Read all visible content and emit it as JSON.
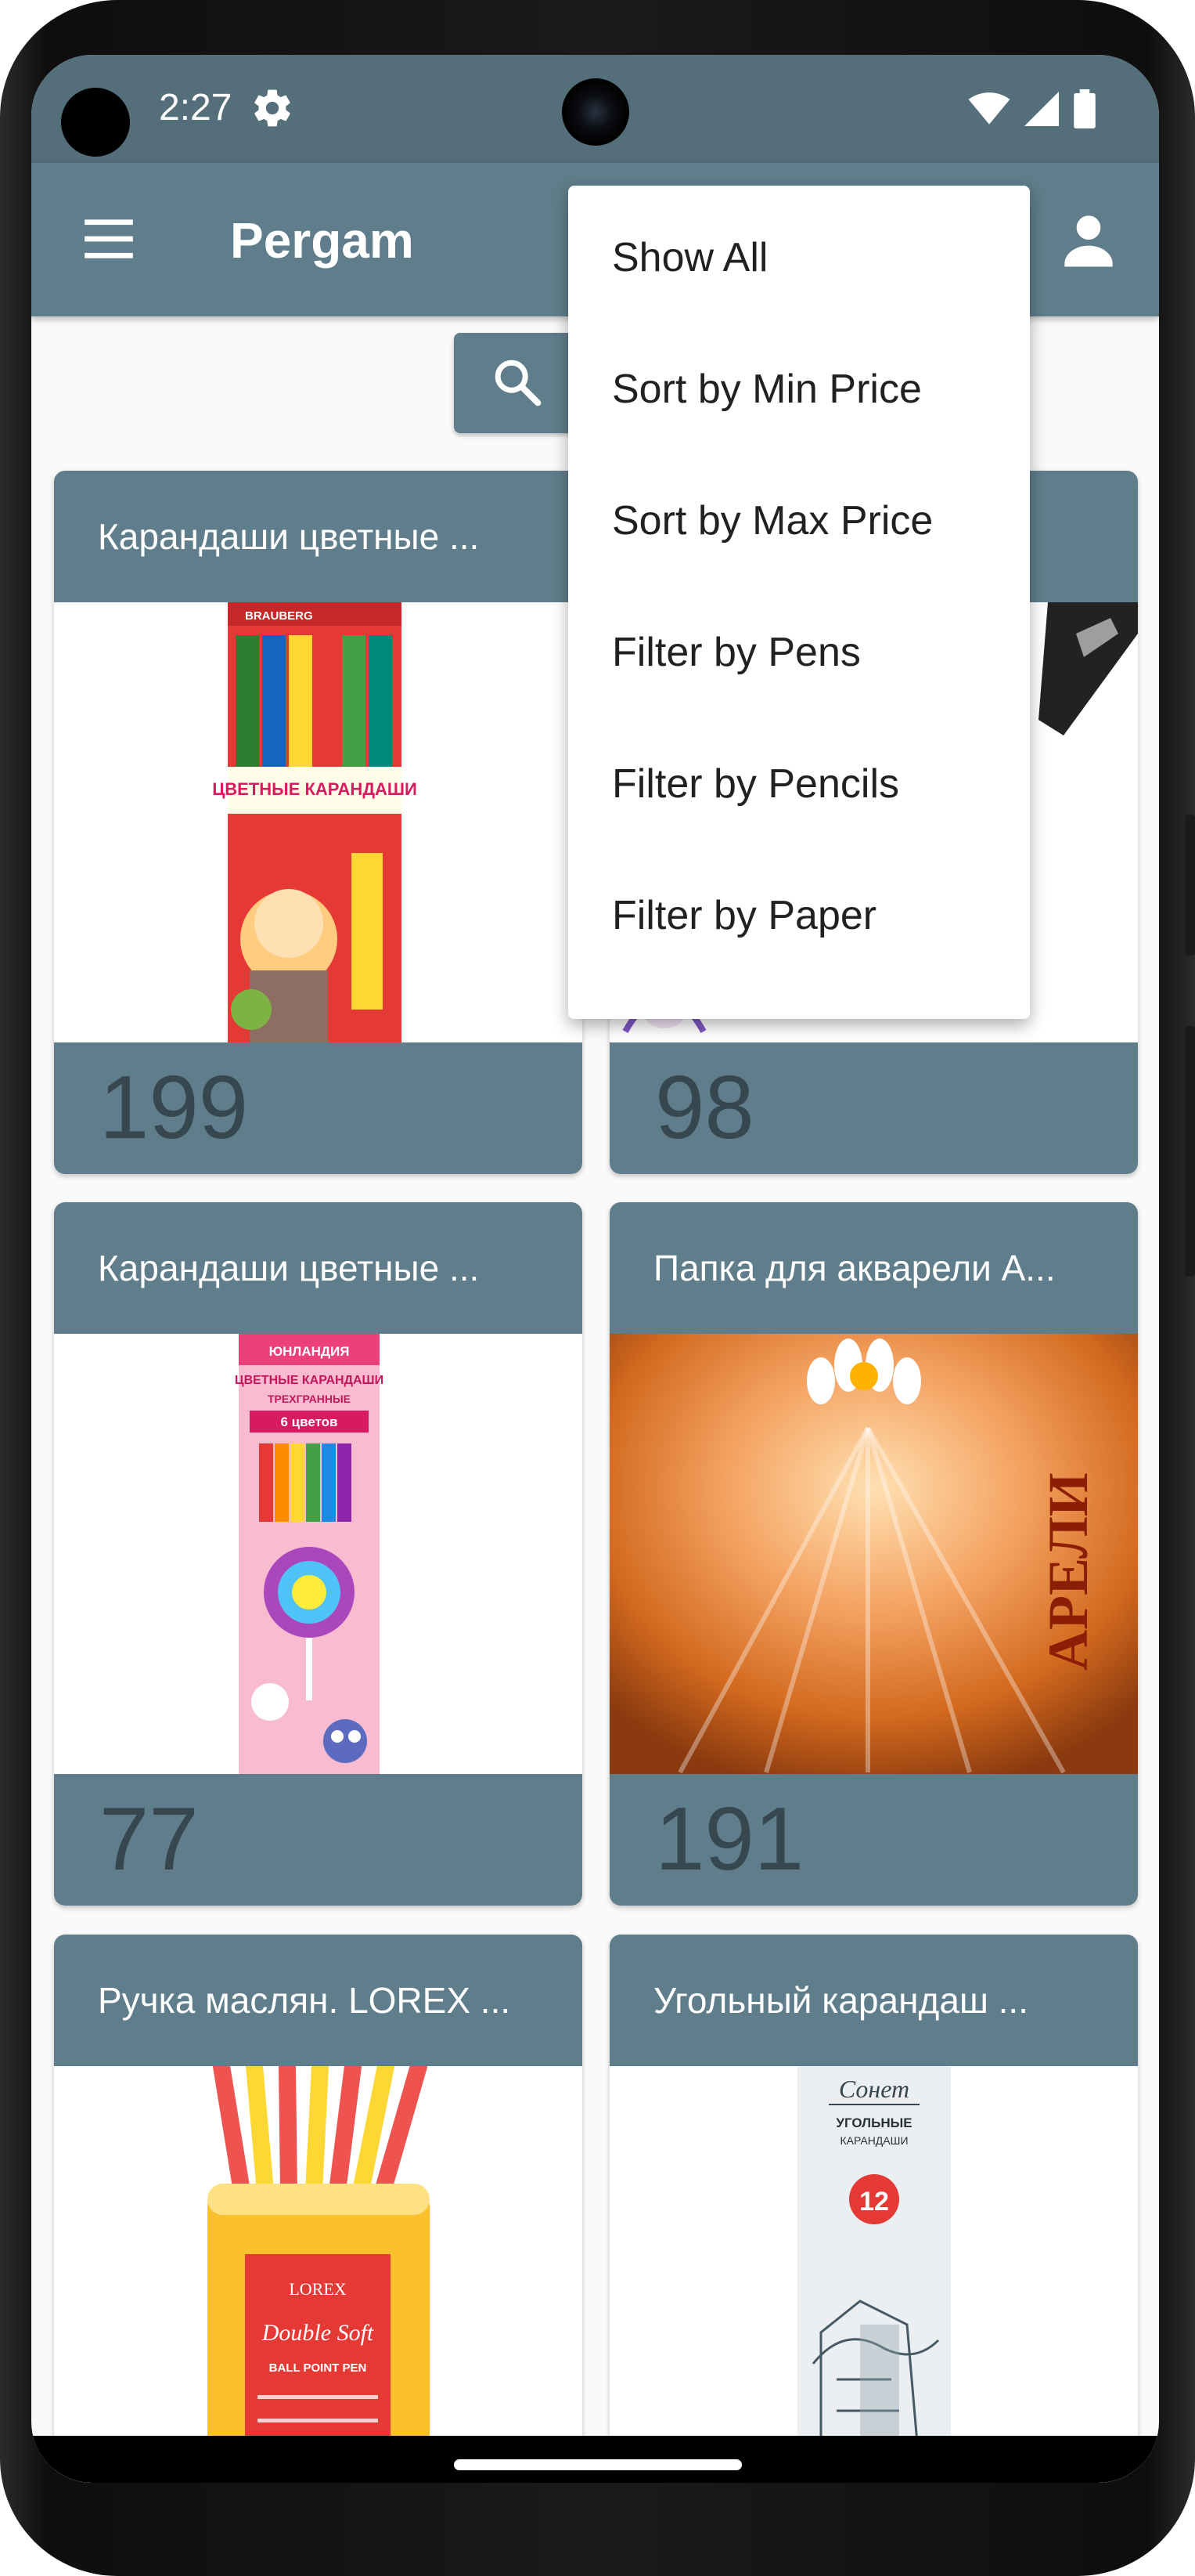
{
  "status_bar": {
    "time": "2:27",
    "icons": [
      "settings-icon",
      "wifi-icon",
      "signal-icon",
      "battery-icon"
    ]
  },
  "app_bar": {
    "title": "Pergam",
    "menu_icon": "hamburger-menu-icon",
    "account_icon": "account-icon"
  },
  "search": {
    "icon": "search-icon"
  },
  "dropdown_menu": {
    "items": [
      {
        "label": "Show All"
      },
      {
        "label": "Sort by Min Price"
      },
      {
        "label": "Sort by Max Price"
      },
      {
        "label": "Filter by Pens"
      },
      {
        "label": "Filter by Pencils"
      },
      {
        "label": "Filter by Paper"
      }
    ]
  },
  "products": [
    {
      "title": "Карандаши цветные ...",
      "price": "199",
      "brand_text": "BRAUBERG",
      "package_text": "ЦВЕТНЫЕ КАРАНДАШИ"
    },
    {
      "title": "",
      "price": "98"
    },
    {
      "title": "Карандаши цветные ...",
      "price": "77",
      "brand_text": "ЮНЛАНДИЯ",
      "package_text": "ЦВЕТНЫЕ КАРАНДАШИ",
      "package_sub": "ТРЕХГРАННЫЕ",
      "package_count": "6 цветов"
    },
    {
      "title": "Папка для акварели А...",
      "price": "191",
      "package_text": "АРЕЛИ"
    },
    {
      "title": "Ручка маслян. LOREX ...",
      "price": "",
      "brand_text": "LOREX",
      "package_text": "Double Soft",
      "package_sub": "BALL POINT PEN"
    },
    {
      "title": "Угольный карандаш ...",
      "price": "",
      "brand_text": "Сонет",
      "package_text": "УГОЛЬНЫЕ",
      "package_sub": "КАРАНДАШИ",
      "package_count": "12"
    }
  ],
  "colors": {
    "primary": "#607d8b",
    "primary_dark": "#546e7a",
    "price_text": "#37474f",
    "background": "#fafafa"
  }
}
